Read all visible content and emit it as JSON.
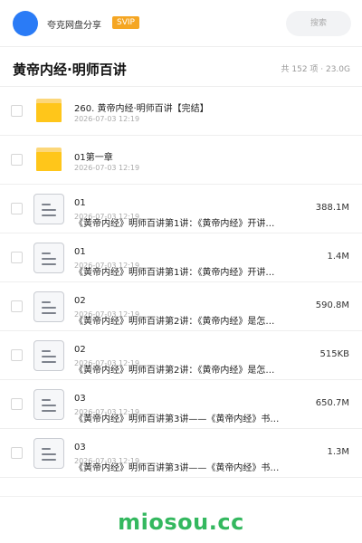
{
  "header": {
    "brand": "夸克网盘分享",
    "badge": "SVIP",
    "search_placeholder": "搜索"
  },
  "folder": {
    "title": "黄帝内经·明师百讲",
    "meta": "共 152 项 · 23.0G"
  },
  "items": [
    {
      "type": "folder",
      "name": "260. 黄帝内经·明师百讲【完结】",
      "date": "2026-07-03 12:19",
      "size": ""
    },
    {
      "type": "folder",
      "name": "01第一章",
      "date": "2026-07-03 12:19",
      "size": ""
    },
    {
      "type": "file",
      "name": "01",
      "date": "2026-07-03 12:19",
      "desc": "《黄帝内经》明师百讲第1讲：《黄帝内经》开讲…",
      "size": "388.1M"
    },
    {
      "type": "file",
      "name": "01",
      "date": "2026-07-03 12:19",
      "desc": "《黄帝内经》明师百讲第1讲：《黄帝内经》开讲…",
      "size": "1.4M"
    },
    {
      "type": "file",
      "name": "02",
      "date": "2026-07-03 12:19",
      "desc": "《黄帝内经》明师百讲第2讲：《黄帝内经》是怎…",
      "size": "590.8M"
    },
    {
      "type": "file",
      "name": "02",
      "date": "2026-07-03 12:19",
      "desc": "《黄帝内经》明师百讲第2讲：《黄帝内经》是怎…",
      "size": "515KB"
    },
    {
      "type": "file",
      "name": "03",
      "date": "2026-07-03 12:19",
      "desc": "《黄帝内经》明师百讲第3讲——《黄帝内经》书…",
      "size": "650.7M"
    },
    {
      "type": "file",
      "name": "03",
      "date": "2026-07-03 12:19",
      "desc": "《黄帝内经》明师百讲第3讲——《黄帝内经》书…",
      "size": "1.3M"
    }
  ],
  "watermark": "miosou.cc"
}
